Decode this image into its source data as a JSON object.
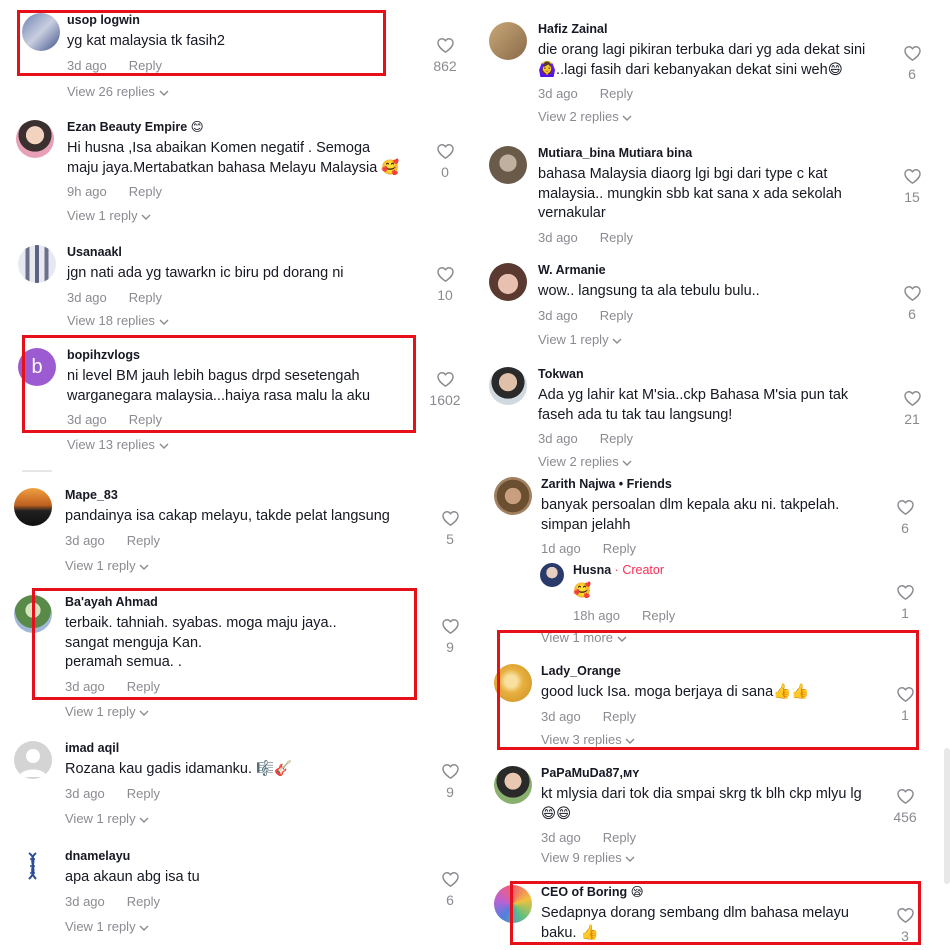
{
  "left": {
    "c1": {
      "author": "usop logwin",
      "text": "yg kat malaysia tk fasih2",
      "time": "3d ago",
      "reply": "Reply",
      "likes": "862",
      "view": "View 26 replies"
    },
    "c2": {
      "author": "Ezan Beauty Empire 😊",
      "text1": "Hi husna ,Isa abaikan Komen negatif . Semoga",
      "text2": "maju jaya.Mertabatkan bahasa Melayu Malaysia 🥰",
      "time": "9h ago",
      "reply": "Reply",
      "likes": "0",
      "view": "View 1 reply"
    },
    "c3": {
      "author": "Usanaakl",
      "text": "jgn nati ada yg tawarkn ic biru pd dorang ni",
      "time": "3d ago",
      "reply": "Reply",
      "likes": "10",
      "view": "View 18 replies"
    },
    "c4": {
      "author": "bopihzvlogs",
      "avatar_letter": "b",
      "text1": "ni level BM jauh lebih bagus drpd sesetengah",
      "text2": "warganegara malaysia...haiya rasa malu la aku",
      "time": "3d ago",
      "reply": "Reply",
      "likes": "1602",
      "view": "View 13 replies"
    },
    "c5": {
      "author": "Mape_83",
      "text": "pandainya isa cakap melayu, takde pelat langsung",
      "time": "3d ago",
      "reply": "Reply",
      "likes": "5",
      "view": "View 1 reply"
    },
    "c6": {
      "author": "Ba'ayah Ahmad",
      "text1": "terbaik. tahniah. syabas. moga maju jaya..",
      "text2": "sangat menguja Kan.",
      "text3": "peramah semua. .",
      "time": "3d ago",
      "reply": "Reply",
      "likes": "9",
      "view": "View 1 reply"
    },
    "c7": {
      "author": "imad aqil",
      "text": "Rozana kau gadis idamanku. 🎼🎸",
      "time": "3d ago",
      "reply": "Reply",
      "likes": "9",
      "view": "View 1 reply"
    },
    "c8": {
      "author": "dnamelayu",
      "text": "apa akaun abg isa tu",
      "time": "3d ago",
      "reply": "Reply",
      "likes": "6",
      "view": "View 1 reply"
    }
  },
  "right": {
    "c1": {
      "author": "Hafiz Zainal",
      "text1": "die orang lagi pikiran terbuka dari yg ada dekat sini",
      "text2": "🙆‍♀️..lagi fasih dari kebanyakan dekat sini weh😄",
      "time": "3d ago",
      "reply": "Reply",
      "likes": "6",
      "view": "View 2 replies"
    },
    "c2": {
      "author": "Mutiara_bina Mutiara bina",
      "text1": "bahasa Malaysia diaorg lgi bgi dari type c kat",
      "text2": "malaysia.. mungkin sbb kat sana x ada sekolah",
      "text3": "vernakular",
      "time": "3d ago",
      "reply": "Reply",
      "likes": "15"
    },
    "c3": {
      "author": "W. Armanie",
      "text": "wow.. langsung ta ala tebulu bulu..",
      "time": "3d ago",
      "reply": "Reply",
      "likes": "6",
      "view": "View 1 reply"
    },
    "c4": {
      "author": "Tokwan",
      "text1": "Ada yg lahir kat M'sia..ckp Bahasa M'sia pun tak",
      "text2": "faseh ada tu tak tau langsung!",
      "time": "3d ago",
      "reply": "Reply",
      "likes": "21",
      "view": "View 2 replies"
    },
    "c5": {
      "author": "Zarith Najwa",
      "friends_sep": " • ",
      "friends": "Friends",
      "text1": "banyak persoalan dlm kepala aku ni. takpelah.",
      "text2": "simpan jelahh",
      "time": "1d ago",
      "reply": "Reply",
      "likes": "6"
    },
    "c5r": {
      "author": "Husna",
      "creator_sep": " · ",
      "creator": "Creator",
      "text": "🥰",
      "time": "18h ago",
      "reply": "Reply",
      "likes": "1",
      "view": "View 1 more"
    },
    "c6": {
      "author": "Lady_Orange",
      "text": "good luck Isa. moga berjaya di sana👍👍",
      "time": "3d ago",
      "reply": "Reply",
      "likes": "1",
      "view": "View 3 replies"
    },
    "c7": {
      "author": "PaPaMuDa87,ᴍʏ",
      "text1": "kt mlysia dari tok dia smpai skrg tk blh ckp mlyu lg",
      "text2": "😄😄",
      "time": "3d ago",
      "reply": "Reply",
      "likes": "456",
      "view": "View 9 replies"
    },
    "c8": {
      "author": "CEO of Boring 😪",
      "text1": "Sedapnya dorang sembang dlm bahasa melayu",
      "text2": "baku. 👍",
      "likes": "3"
    }
  },
  "colors": {
    "highlight": "#e5101a",
    "creator": "#fe2c55",
    "muted": "#8a8b91",
    "text": "#161823"
  }
}
